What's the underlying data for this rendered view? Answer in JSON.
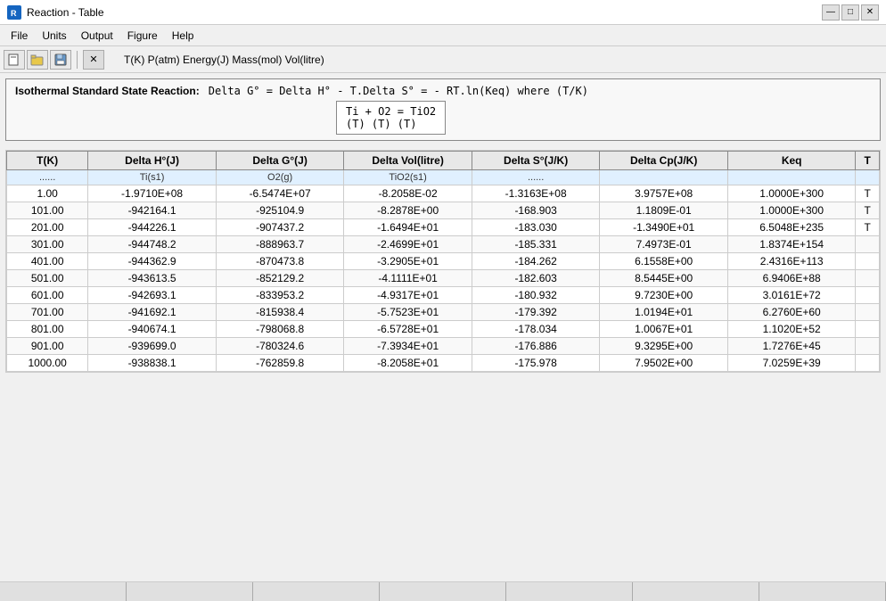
{
  "window": {
    "title": "Reaction - Table",
    "icon_label": "R"
  },
  "title_buttons": {
    "minimize": "—",
    "maximize": "□",
    "close": "✕"
  },
  "menu": {
    "items": [
      "File",
      "Units",
      "Output",
      "Figure",
      "Help"
    ]
  },
  "toolbar": {
    "units_label": "T(K)  P(atm)  Energy(J)  Mass(mol)  Vol(litre)",
    "btn_new": "□",
    "btn_open": "📂",
    "btn_save": "💾",
    "btn_x": "✕"
  },
  "isothermal": {
    "title": "Isothermal Standard State Reaction:",
    "formula": "Delta G° = Delta H° - T.Delta S° = - RT.ln(Keq)    where (T/K)",
    "reaction_line1": "Ti +  O2  =  TiO2",
    "reaction_line2": "(T)   (T)       (T)"
  },
  "table": {
    "headers": [
      "T(K)",
      "Delta H°(J)",
      "Delta G°(J)",
      "Delta Vol(litre)",
      "Delta S°(J/K)",
      "Delta Cp(J/K)",
      "Keq",
      "T"
    ],
    "subheaders": [
      "......",
      "Ti(s1)",
      "O2(g)",
      "TiO2(s1)",
      "......",
      "",
      "",
      ""
    ],
    "rows": [
      {
        "t": "1.00",
        "dh": "-1.9710E+08",
        "dg": "-6.5474E+07",
        "dv": "-8.2058E-02",
        "ds": "-1.3163E+08",
        "dcp": "3.9757E+08",
        "keq": "1.0000E+300",
        "flag": "T"
      },
      {
        "t": "101.00",
        "dh": "-942164.1",
        "dg": "-925104.9",
        "dv": "-8.2878E+00",
        "ds": "-168.903",
        "dcp": "1.1809E-01",
        "keq": "1.0000E+300",
        "flag": "T"
      },
      {
        "t": "201.00",
        "dh": "-944226.1",
        "dg": "-907437.2",
        "dv": "-1.6494E+01",
        "ds": "-183.030",
        "dcp": "-1.3490E+01",
        "keq": "6.5048E+235",
        "flag": "T"
      },
      {
        "t": "301.00",
        "dh": "-944748.2",
        "dg": "-888963.7",
        "dv": "-2.4699E+01",
        "ds": "-185.331",
        "dcp": "7.4973E-01",
        "keq": "1.8374E+154",
        "flag": ""
      },
      {
        "t": "401.00",
        "dh": "-944362.9",
        "dg": "-870473.8",
        "dv": "-3.2905E+01",
        "ds": "-184.262",
        "dcp": "6.1558E+00",
        "keq": "2.4316E+113",
        "flag": ""
      },
      {
        "t": "501.00",
        "dh": "-943613.5",
        "dg": "-852129.2",
        "dv": "-4.1111E+01",
        "ds": "-182.603",
        "dcp": "8.5445E+00",
        "keq": "6.9406E+88",
        "flag": ""
      },
      {
        "t": "601.00",
        "dh": "-942693.1",
        "dg": "-833953.2",
        "dv": "-4.9317E+01",
        "ds": "-180.932",
        "dcp": "9.7230E+00",
        "keq": "3.0161E+72",
        "flag": ""
      },
      {
        "t": "701.00",
        "dh": "-941692.1",
        "dg": "-815938.4",
        "dv": "-5.7523E+01",
        "ds": "-179.392",
        "dcp": "1.0194E+01",
        "keq": "6.2760E+60",
        "flag": ""
      },
      {
        "t": "801.00",
        "dh": "-940674.1",
        "dg": "-798068.8",
        "dv": "-6.5728E+01",
        "ds": "-178.034",
        "dcp": "1.0067E+01",
        "keq": "1.1020E+52",
        "flag": ""
      },
      {
        "t": "901.00",
        "dh": "-939699.0",
        "dg": "-780324.6",
        "dv": "-7.3934E+01",
        "ds": "-176.886",
        "dcp": "9.3295E+00",
        "keq": "1.7276E+45",
        "flag": ""
      },
      {
        "t": "1000.00",
        "dh": "-938838.1",
        "dg": "-762859.8",
        "dv": "-8.2058E+01",
        "ds": "-175.978",
        "dcp": "7.9502E+00",
        "keq": "7.0259E+39",
        "flag": ""
      }
    ]
  },
  "bottom_segments": [
    "",
    "",
    "",
    "",
    "",
    "",
    ""
  ]
}
